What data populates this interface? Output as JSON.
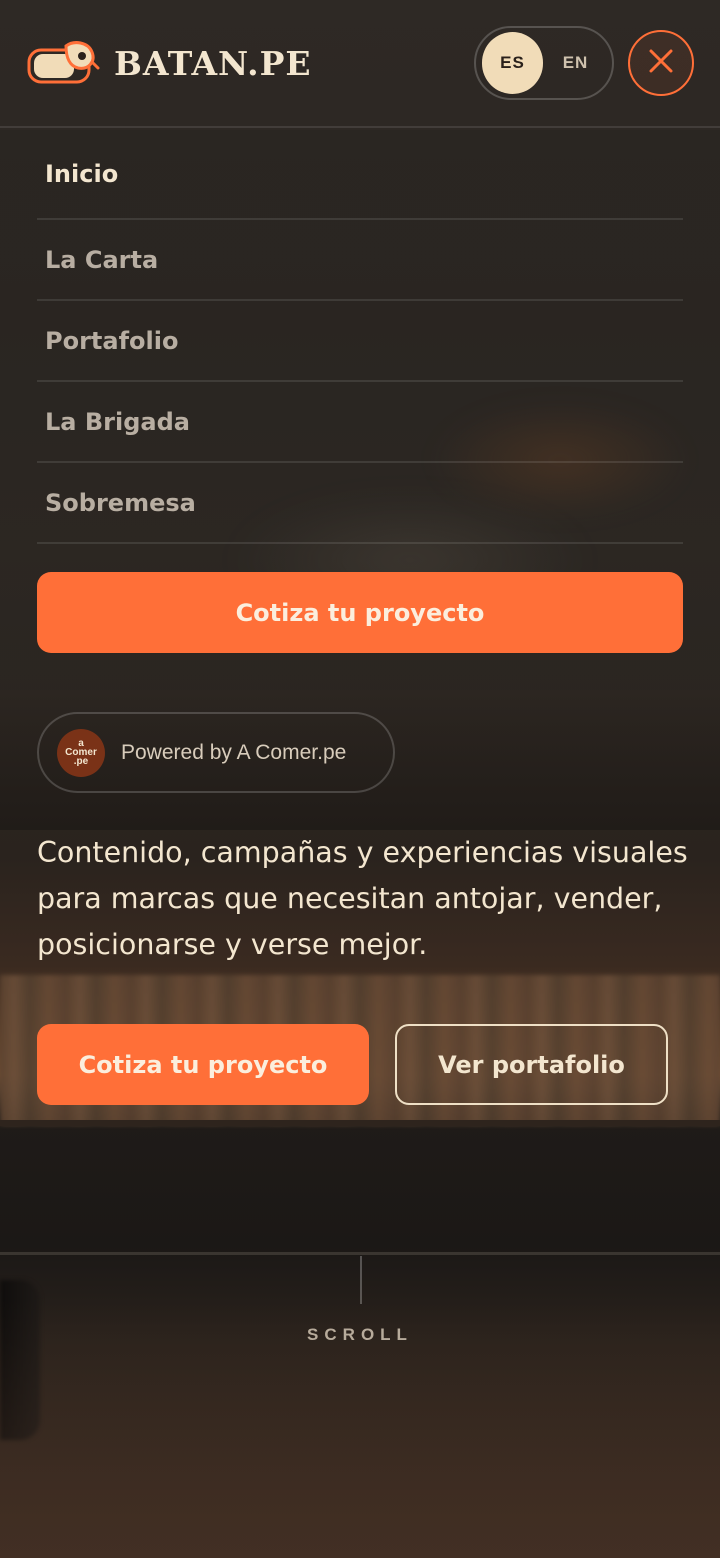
{
  "header": {
    "brand_name": "BATAN.PE",
    "logo_icon": "batan-logo-icon",
    "languages": [
      {
        "code": "ES",
        "active": true
      },
      {
        "code": "EN",
        "active": false
      }
    ],
    "close_icon": "close-icon",
    "accent_color": "#ff6f38"
  },
  "menu": {
    "items": [
      {
        "label": "Inicio",
        "current": true
      },
      {
        "label": "La Carta",
        "current": false
      },
      {
        "label": "Portafolio",
        "current": false
      },
      {
        "label": "La Brigada",
        "current": false
      },
      {
        "label": "Sobremesa",
        "current": false
      }
    ],
    "cta_label": "Cotiza tu proyecto"
  },
  "powered": {
    "logo_text_1": "a",
    "logo_text_2": "Comer",
    "logo_text_3": ".pe",
    "label": "Powered by A Comer.pe"
  },
  "hero": {
    "description": "Contenido, campañas y experiencias visuales para marcas que necesitan antojar, vender, posicionarse y verse mejor.",
    "primary_cta": "Cotiza tu proyecto",
    "secondary_cta": "Ver portafolio"
  },
  "scroll": {
    "label": "SCROLL"
  },
  "colors": {
    "accent": "#ff6f38",
    "cream": "#f1dcb8",
    "text": "#f3e6cf"
  }
}
